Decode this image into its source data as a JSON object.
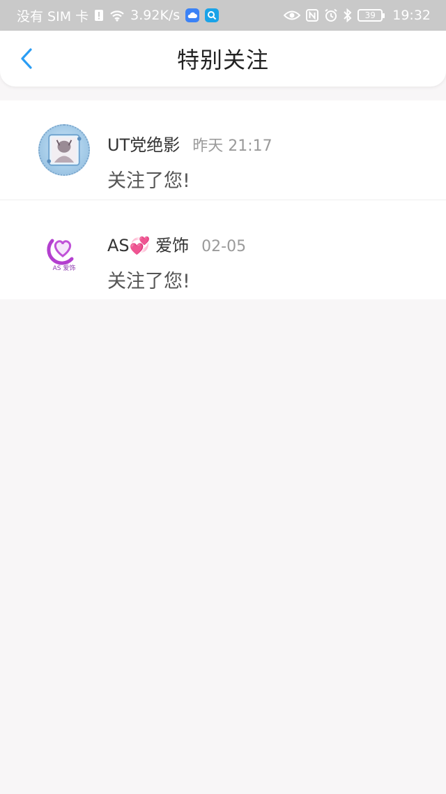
{
  "status_bar": {
    "carrier": "没有 SIM 卡",
    "speed": "3.92K/s",
    "battery": "39",
    "time": "19:32"
  },
  "header": {
    "title": "特别关注"
  },
  "notifications": [
    {
      "name": "UT党绝影",
      "time": "昨天 21:17",
      "message": "关注了您!"
    },
    {
      "name": "AS💞 爱饰",
      "time": "02-05",
      "message": "关注了您!"
    }
  ],
  "avatar2_text": "AS 爱饰",
  "colors": {
    "accent": "#2a9df4",
    "status_bar_bg": "#c9c9c9",
    "page_bg": "#f8f6f7"
  }
}
